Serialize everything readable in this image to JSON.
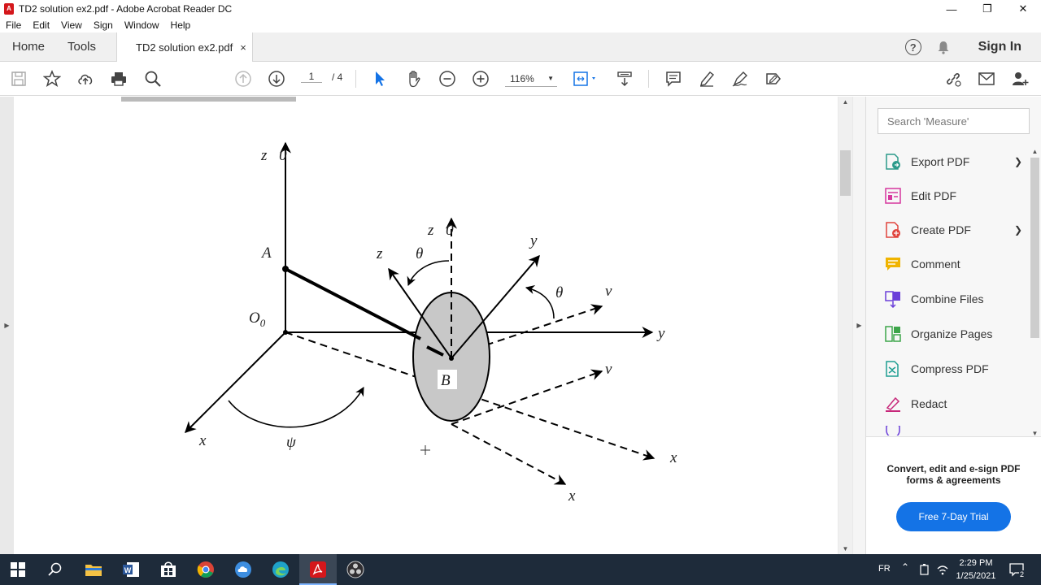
{
  "window": {
    "title": "TD2 solution ex2.pdf - Adobe Acrobat Reader DC"
  },
  "menu": [
    "File",
    "Edit",
    "View",
    "Sign",
    "Window",
    "Help"
  ],
  "tabs": {
    "home": "Home",
    "tools": "Tools",
    "document": "TD2 solution ex2.pdf",
    "close": "×"
  },
  "header": {
    "sign_in": "Sign In"
  },
  "toolbar": {
    "page_current": "1",
    "page_total": "/ 4",
    "zoom": "116%"
  },
  "figure_labels": {
    "z0_top": "z⃗0",
    "A": "A",
    "O0": "O",
    "O0_sub": "0",
    "z0_dashed": "z⃗0",
    "z": "z⃗",
    "theta1": "θ",
    "y": "y⃗",
    "theta2": "θ",
    "v1": "v⃗",
    "y0": "y⃗",
    "v2": "v⃗",
    "B": "B",
    "x0": "x⃗",
    "psi": "ψ",
    "x1": "x⃗",
    "x2": "x⃗"
  },
  "right_panel": {
    "search_placeholder": "Search 'Measure'",
    "tools": [
      {
        "label": "Export PDF",
        "icon": "export-pdf-icon",
        "color": "#2b9a8a"
      },
      {
        "label": "Edit PDF",
        "icon": "edit-pdf-icon",
        "color": "#d6379e"
      },
      {
        "label": "Create PDF",
        "icon": "create-pdf-icon",
        "color": "#e0433c"
      },
      {
        "label": "Comment",
        "icon": "comment-icon",
        "color": "#f0b400"
      },
      {
        "label": "Combine Files",
        "icon": "combine-files-icon",
        "color": "#6a3fd9"
      },
      {
        "label": "Organize Pages",
        "icon": "organize-pages-icon",
        "color": "#3da54a"
      },
      {
        "label": "Compress PDF",
        "icon": "compress-pdf-icon",
        "color": "#1f9e92"
      },
      {
        "label": "Redact",
        "icon": "redact-icon",
        "color": "#c7287a"
      }
    ],
    "promo_text": "Convert, edit and e-sign PDF forms & agreements",
    "trial_button": "Free 7-Day Trial"
  },
  "taskbar": {
    "language": "FR",
    "time": "2:29 PM",
    "date": "1/25/2021",
    "notification_count": "2"
  }
}
